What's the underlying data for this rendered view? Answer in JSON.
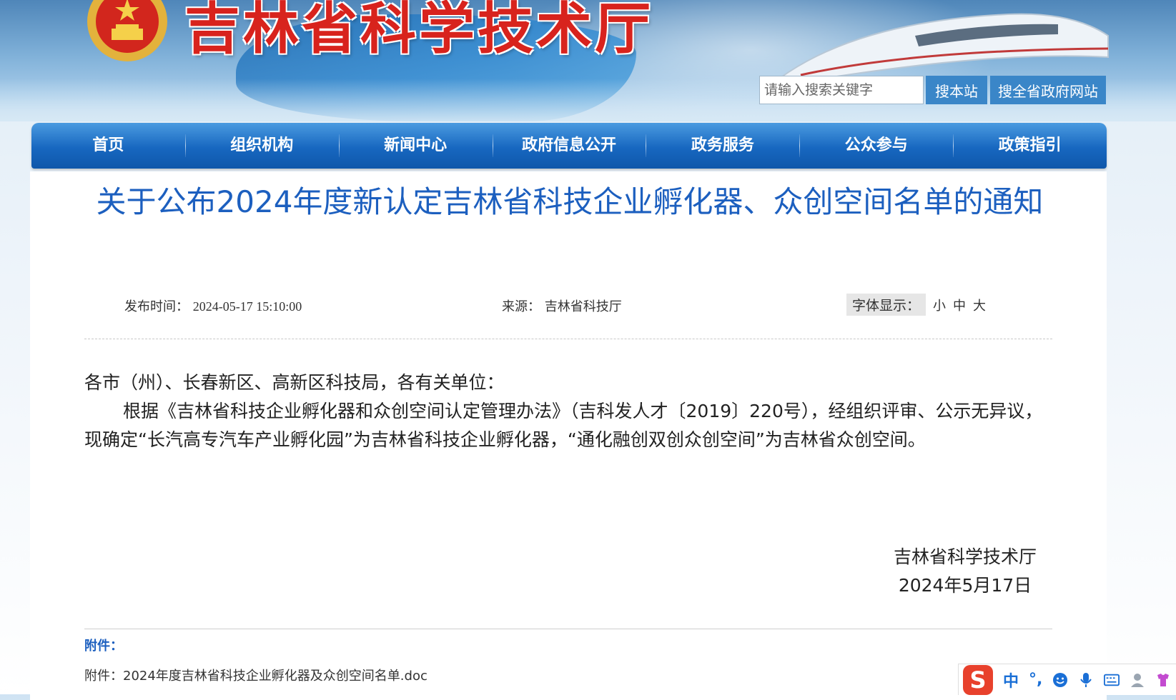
{
  "header": {
    "site_title": "吉林省科学技术厅",
    "search_placeholder": "请输入搜索关键字",
    "search_site_label": "搜本站",
    "search_province_label": "搜全省政府网站"
  },
  "nav": {
    "items": [
      "首页",
      "组织机构",
      "新闻中心",
      "政府信息公开",
      "政务服务",
      "公众参与",
      "政策指引"
    ]
  },
  "article": {
    "title": "关于公布2024年度新认定吉林省科技企业孵化器、众创空间名单的通知",
    "date_label": "发布时间：",
    "date_value": "2024-05-17 15:10:00",
    "source_label": "来源：",
    "source_value": "吉林省科技厅",
    "font_label": "字体显示：",
    "font_small": "小",
    "font_medium": "中",
    "font_large": "大",
    "salutation": "各市（州）、长春新区、高新区科技局，各有关单位：",
    "paragraph": "根据《吉林省科技企业孵化器和众创空间认定管理办法》（吉科发人才〔2019〕220号），经组织评审、公示无异议，现确定“长汽高专汽车产业孵化园”为吉林省科技企业孵化器，“通化融创双创众创空间”为吉林省众创空间。",
    "signature_org": "吉林省科学技术厅",
    "signature_date": "2024年5月17日",
    "attachment_heading": "附件：",
    "attachment_file": "附件：2024年度吉林省科技企业孵化器及众创空间名单.doc"
  },
  "ime": {
    "logo": "S",
    "mode": "中",
    "punct": "°,",
    "icons": [
      "emoji-icon",
      "microphone-icon",
      "keyboard-icon",
      "user-icon",
      "skin-icon"
    ]
  },
  "colors": {
    "title_red": "#d8231d",
    "nav_blue": "#1767c0",
    "article_title_blue": "#1c5fbf"
  }
}
